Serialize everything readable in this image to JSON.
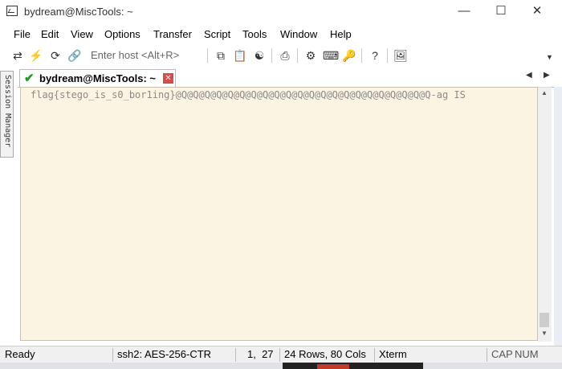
{
  "window": {
    "title": "bydream@MiscTools: ~"
  },
  "menu": [
    "File",
    "Edit",
    "View",
    "Options",
    "Transfer",
    "Script",
    "Tools",
    "Window",
    "Help"
  ],
  "toolbar": {
    "quick_connect_placeholder": "Enter host <Alt+R>"
  },
  "side_panel": {
    "label": "Session Manager"
  },
  "tab": {
    "title": "bydream@MiscTools: ~"
  },
  "terminal": {
    "line1": "flag{stego_is_s0_bor1ing}@Q@Q@Q@Q@Q@Q@Q@Q@Q@Q@Q@Q@Q@Q@Q@Q@Q@Q@Q@Q@Q@Q-ag IS"
  },
  "status": {
    "state": "Ready",
    "cipher": "ssh2: AES-256-CTR",
    "cursor": "1,  27",
    "dimensions": "24 Rows, 80 Cols",
    "emulation": "Xterm",
    "caps": "CAP",
    "num": "NUM"
  },
  "colors": {
    "terminal_bg": "#fbf4e2",
    "terminal_text": "#8a8a8a",
    "tab_close": "#d64b4b",
    "connected_check": "#1f9a1f"
  }
}
